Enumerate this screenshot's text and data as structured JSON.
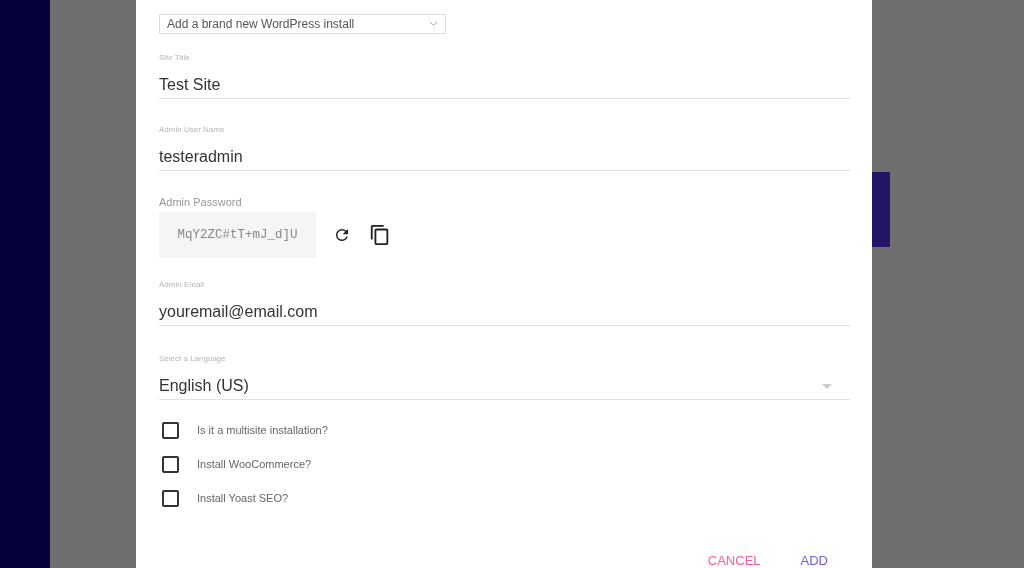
{
  "install_select": {
    "value": "Add a brand new WordPress install"
  },
  "fields": [
    {
      "label": "Site Title",
      "value": "Test Site"
    },
    {
      "label": "Admin User Name",
      "value": "testeradmin"
    }
  ],
  "password": {
    "label": "Admin Password",
    "value": "MqY2ZC#tT+mJ_d]U"
  },
  "email": {
    "label": "Admin Email",
    "value": "youremail@email.com"
  },
  "language": {
    "label": "Select a Language",
    "value": "English (US)"
  },
  "options": [
    {
      "label": "Is it a multisite installation?",
      "checked": false
    },
    {
      "label": "Install WooCommerce?",
      "checked": false
    },
    {
      "label": "Install Yoast SEO?",
      "checked": false
    }
  ],
  "actions": {
    "cancel": "CANCEL",
    "add": "ADD"
  }
}
